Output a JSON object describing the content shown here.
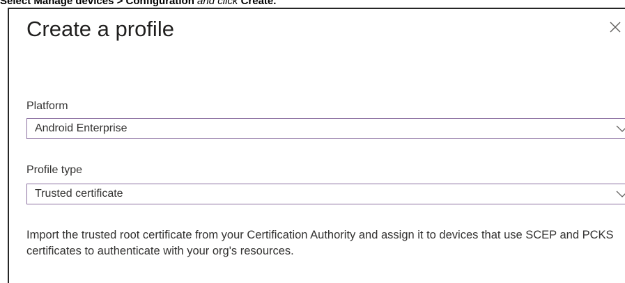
{
  "caption": {
    "part1": "Select ",
    "part2": "Manage devices",
    "part3": " > ",
    "part4": "Configuration",
    "part5": " and click ",
    "part6": "Create."
  },
  "dialog": {
    "title": "Create a profile",
    "close_icon": "close-icon",
    "platform": {
      "label": "Platform",
      "value": "Android Enterprise"
    },
    "profile_type": {
      "label": "Profile type",
      "value": "Trusted certificate"
    },
    "description": "Import the trusted root certificate from your Certification Authority and assign it to devices that use SCEP and PCKS certificates to authenticate with your org's resources."
  },
  "colors": {
    "dropdown_border": "#8a6ea0",
    "text": "#323130",
    "panel_border": "#262626"
  }
}
